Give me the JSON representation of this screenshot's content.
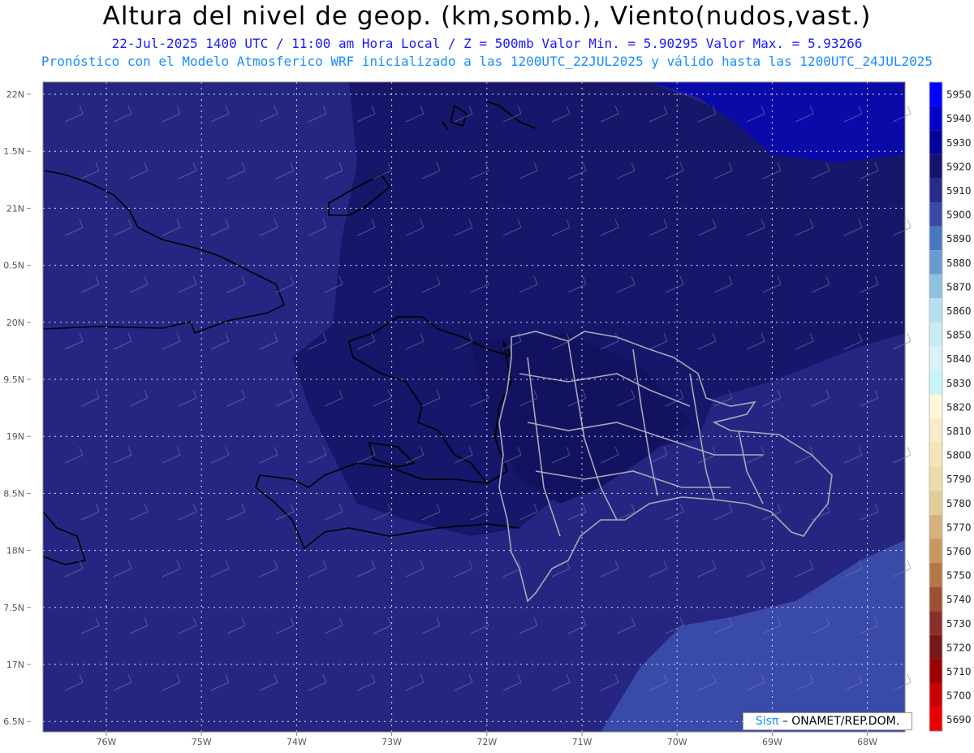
{
  "header": {
    "title": "Altura del nivel de geop. (km,somb.), Viento(nudos,vast.)",
    "line1": "22-Jul-2025  1400 UTC / 11:00 am Hora Local / Z = 500mb   Valor Min. = 5.90295  Valor Max. = 5.93266",
    "line2": "Pronóstico con el Modelo Atmosferico WRF inicializado a las 1200UTC_22JUL2025 y válido hasta las  1200UTC_24JUL2025"
  },
  "axes": {
    "lat_labels": [
      "22N",
      "1.5N",
      "21N",
      "0.5N",
      "20N",
      "9.5N",
      "19N",
      "8.5N",
      "18N",
      "7.5N",
      "17N",
      "6.5N"
    ],
    "lon_labels": [
      "76W",
      "75W",
      "74W",
      "73W",
      "72W",
      "71W",
      "70W",
      "69W",
      "68W"
    ]
  },
  "colorbar": {
    "labels": [
      "5950",
      "5940",
      "5930",
      "5920",
      "5910",
      "5900",
      "5890",
      "5880",
      "5870",
      "5860",
      "5850",
      "5840",
      "5830",
      "5820",
      "5810",
      "5800",
      "5790",
      "5780",
      "5770",
      "5760",
      "5750",
      "5740",
      "5730",
      "5720",
      "5710",
      "5700",
      "5690"
    ],
    "colors": [
      "#0000ff",
      "#0000c8",
      "#00009a",
      "#14146e",
      "#2a2a8a",
      "#3a4aa8",
      "#4a78c0",
      "#6a9ad0",
      "#8ec0e0",
      "#b4e0ee",
      "#c8ecf4",
      "#d8f2f8",
      "#c8f4f8",
      "#fff8d8",
      "#f8ecc8",
      "#f4e4b8",
      "#ecdcac",
      "#e4cc98",
      "#d8b07c",
      "#c89860",
      "#b47848",
      "#9c5034",
      "#883028",
      "#781818",
      "#9c0000",
      "#c80000",
      "#e80000"
    ]
  },
  "credit": {
    "sis": "Sisπ",
    "text": "– ONAMET/REP.DOM."
  }
}
